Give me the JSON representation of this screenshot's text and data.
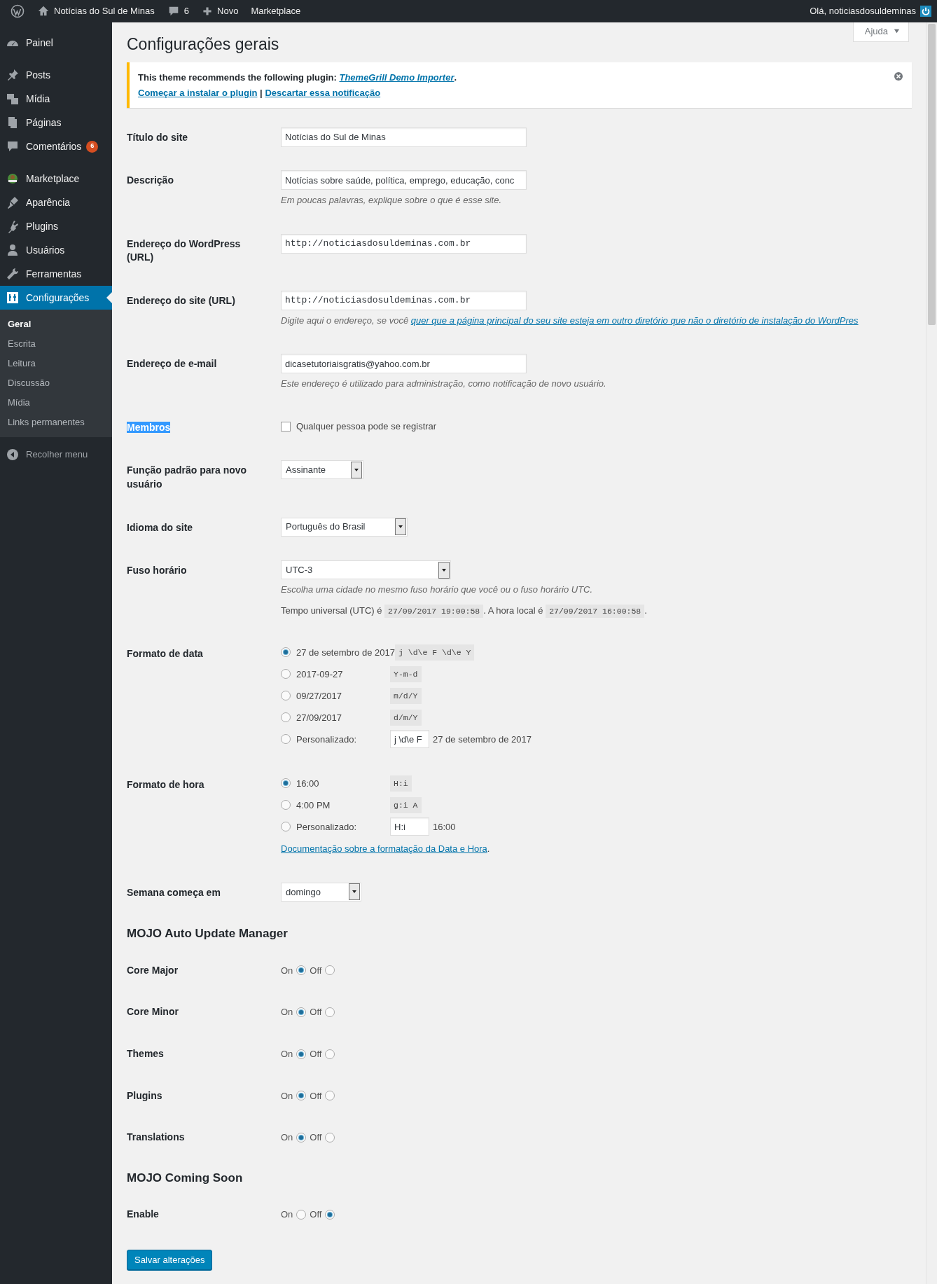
{
  "admin_bar": {
    "site_name": "Notícias do Sul de Minas",
    "comments_count": "6",
    "new_label": "Novo",
    "marketplace": "Marketplace",
    "greeting": "Olá, noticiasdosuldeminas"
  },
  "sidebar": {
    "groups": [
      {
        "items": [
          {
            "label": "Painel",
            "selected": false
          }
        ]
      },
      {
        "items": [
          {
            "label": "Posts",
            "selected": false
          },
          {
            "label": "Mídia",
            "selected": false
          },
          {
            "label": "Páginas",
            "selected": false
          },
          {
            "label": "Comentários",
            "selected": false,
            "badge": "6"
          }
        ]
      },
      {
        "items": [
          {
            "label": "Marketplace",
            "selected": false
          },
          {
            "label": "Aparência",
            "selected": false
          },
          {
            "label": "Plugins",
            "selected": false
          },
          {
            "label": "Usuários",
            "selected": false
          },
          {
            "label": "Ferramentas",
            "selected": false
          },
          {
            "label": "Configurações",
            "selected": true,
            "children": [
              {
                "label": "Geral",
                "selected": true
              },
              {
                "label": "Escrita",
                "selected": false
              },
              {
                "label": "Leitura",
                "selected": false
              },
              {
                "label": "Discussão",
                "selected": false
              },
              {
                "label": "Mídia",
                "selected": false
              },
              {
                "label": "Links permanentes",
                "selected": false
              }
            ]
          }
        ]
      }
    ],
    "collapse_label": "Recolher menu"
  },
  "help_button": "Ajuda",
  "page_title": "Configurações gerais",
  "notice": {
    "text": "This theme recommends the following plugin: ",
    "plugin_link": "ThemeGrill Demo Importer",
    "text_end": ".",
    "install_link": "Começar a instalar o plugin",
    "separator": " | ",
    "dismiss_link": "Descartar essa notificação"
  },
  "fields": [
    {
      "kind": "text",
      "label": "Título do site",
      "value": "Notícias do Sul de Minas"
    },
    {
      "kind": "text",
      "label": "Descrição",
      "value": "Notícias sobre saúde, política, emprego, educação, conc",
      "description": "Em poucas palavras, explique sobre o que é esse site."
    },
    {
      "kind": "url",
      "label": "Endereço do WordPress (URL)",
      "value": "http://noticiasdosuldeminas.com.br"
    },
    {
      "kind": "url",
      "label": "Endereço do site (URL)",
      "value": "http://noticiasdosuldeminas.com.br",
      "description": "Digite aqui o endereço, se você ",
      "description_link": "quer que a página principal do seu site esteja em outro diretório que não o diretório de instalação do WordPres"
    },
    {
      "kind": "text",
      "label": "Endereço de e-mail",
      "value": "dicasetutoriaisgratis@yahoo.com.br",
      "description": "Este endereço é utilizado para administração, como notificação de novo usuário."
    },
    {
      "kind": "checkbox",
      "label": "Membros",
      "highlighted": true,
      "text": "Qualquer pessoa pode se registrar",
      "checked": false
    },
    {
      "kind": "select",
      "label": "Função padrão para novo usuário",
      "value": "Assinante"
    },
    {
      "kind": "select",
      "label": "Idioma do site",
      "value": "Português do Brasil"
    },
    {
      "kind": "select",
      "label": "Fuso horário",
      "value": "UTC-3",
      "description": "Escolha uma cidade no mesmo fuso horário que você ou o fuso horário UTC.",
      "time_info": [
        {
          "kind": "text",
          "text": "Tempo universal (UTC) é "
        },
        {
          "kind": "code",
          "text": "27/09/2017 19:00:58"
        },
        {
          "kind": "text",
          "text": ". A hora local é "
        },
        {
          "kind": "code",
          "text": "27/09/2017 16:00:58"
        },
        {
          "kind": "text",
          "text": "."
        }
      ]
    },
    {
      "kind": "formats",
      "label": "Formato de data",
      "options": [
        {
          "kind": "preset",
          "label": "27 de setembro de 2017",
          "code": "j \\d\\e F \\d\\e Y",
          "selected": true
        },
        {
          "kind": "preset",
          "label": "2017-09-27",
          "code": "Y-m-d",
          "selected": false
        },
        {
          "kind": "preset",
          "label": "09/27/2017",
          "code": "m/d/Y",
          "selected": false
        },
        {
          "kind": "preset",
          "label": "27/09/2017",
          "code": "d/m/Y",
          "selected": false
        },
        {
          "kind": "custom",
          "label": "Personalizado:",
          "value": "j \\d\\e F",
          "preview": "27 de setembro de 2017",
          "selected": false
        }
      ]
    },
    {
      "kind": "formats",
      "label": "Formato de hora",
      "options": [
        {
          "kind": "preset",
          "label": "16:00",
          "code": "H:i",
          "selected": true
        },
        {
          "kind": "preset",
          "label": "4:00 PM",
          "code": "g:i A",
          "selected": false
        },
        {
          "kind": "custom",
          "label": "Personalizado:",
          "value": "H:i",
          "preview": "16:00",
          "selected": false
        }
      ],
      "doc_link": "Documentação sobre a formatação da Data e Hora",
      "doc_suffix": "."
    },
    {
      "kind": "select",
      "label": "Semana começa em",
      "value": "domingo"
    }
  ],
  "sections": [
    {
      "title": "MOJO Auto Update Manager",
      "rows": [
        {
          "label": "Core Major",
          "options": [
            {
              "label": "On",
              "selected": true
            },
            {
              "label": "Off",
              "selected": false
            }
          ]
        },
        {
          "label": "Core Minor",
          "options": [
            {
              "label": "On",
              "selected": true
            },
            {
              "label": "Off",
              "selected": false
            }
          ]
        },
        {
          "label": "Themes",
          "options": [
            {
              "label": "On",
              "selected": true
            },
            {
              "label": "Off",
              "selected": false
            }
          ]
        },
        {
          "label": "Plugins",
          "options": [
            {
              "label": "On",
              "selected": true
            },
            {
              "label": "Off",
              "selected": false
            }
          ]
        },
        {
          "label": "Translations",
          "options": [
            {
              "label": "On",
              "selected": true
            },
            {
              "label": "Off",
              "selected": false
            }
          ]
        }
      ]
    },
    {
      "title": "MOJO Coming Soon",
      "rows": [
        {
          "label": "Enable",
          "options": [
            {
              "label": "On",
              "selected": false
            },
            {
              "label": "Off",
              "selected": true
            }
          ]
        }
      ]
    }
  ],
  "save_button": "Salvar alterações"
}
